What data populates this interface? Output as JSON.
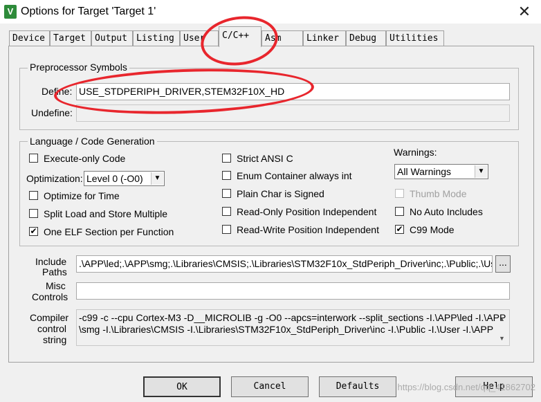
{
  "window": {
    "title": "Options for Target 'Target 1'",
    "icon_text": "V",
    "close_glyph": "✕"
  },
  "tabs": [
    "Device",
    "Target",
    "Output",
    "Listing",
    "User",
    "C/C++",
    "Asm",
    "Linker",
    "Debug",
    "Utilities"
  ],
  "active_tab": "C/C++",
  "preprocessor": {
    "group_label": "Preprocessor Symbols",
    "define_label": "Define:",
    "define_value": "USE_STDPERIPH_DRIVER,STEM32F10X_HD",
    "undefine_label": "Undefine:",
    "undefine_value": ""
  },
  "language": {
    "group_label": "Language / Code Generation",
    "execute_only": {
      "label": "Execute-only Code",
      "checked": false
    },
    "optimization_label": "Optimization:",
    "optimization_value": "Level 0 (-O0)",
    "optimize_time": {
      "label": "Optimize for Time",
      "checked": false
    },
    "split_load": {
      "label": "Split Load and Store Multiple",
      "checked": false
    },
    "one_elf": {
      "label": "One ELF Section per Function",
      "checked": true
    },
    "strict_ansi": {
      "label": "Strict ANSI C",
      "checked": false
    },
    "enum_int": {
      "label": "Enum Container always int",
      "checked": false
    },
    "plain_char": {
      "label": "Plain Char is Signed",
      "checked": false
    },
    "ro_pi": {
      "label": "Read-Only Position Independent",
      "checked": false
    },
    "rw_pi": {
      "label": "Read-Write Position Independent",
      "checked": false
    },
    "warnings_label": "Warnings:",
    "warnings_value": "All Warnings",
    "thumb_mode": {
      "label": "Thumb Mode",
      "checked": false,
      "disabled": true
    },
    "no_auto_includes": {
      "label": "No Auto Includes",
      "checked": false
    },
    "c99_mode": {
      "label": "C99 Mode",
      "checked": true
    }
  },
  "include_paths": {
    "label_line1": "Include",
    "label_line2": "Paths",
    "value": ".\\APP\\led;.\\APP\\smg;.\\Libraries\\CMSIS;.\\Libraries\\STM32F10x_StdPeriph_Driver\\inc;.\\Public;.\\Use",
    "browse_label": "..."
  },
  "misc_controls": {
    "label_line1": "Misc",
    "label_line2": "Controls",
    "value": ""
  },
  "compiler_string": {
    "label_line1": "Compiler",
    "label_line2": "control",
    "label_line3": "string",
    "line1": "-c99 -c --cpu Cortex-M3 -D__MICROLIB -g -O0 --apcs=interwork --split_sections -I.\\APP\\led -I.\\APP",
    "line2": "\\smg -I.\\Libraries\\CMSIS -I.\\Libraries\\STM32F10x_StdPeriph_Driver\\inc -I.\\Public -I.\\User -I.\\APP"
  },
  "buttons": {
    "ok": "OK",
    "cancel": "Cancel",
    "defaults": "Defaults",
    "help": "Help"
  },
  "watermark": "https://blog.csdn.net/qq_41862702",
  "colors": {
    "annotation": "#e8262d",
    "panel": "#f0f0f0"
  }
}
